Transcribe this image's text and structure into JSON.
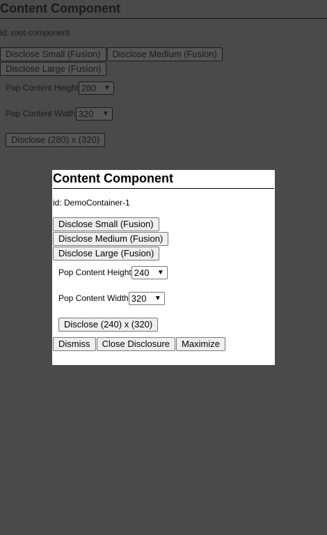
{
  "root": {
    "title": "Content Component",
    "id_text": "id: root-component",
    "buttons": {
      "small": "Disclose Small (Fusion)",
      "medium": "Disclose Medium (Fusion)",
      "large": "Disclose Large (Fusion)"
    },
    "height_label": "Pop Content Height",
    "height_value": "280",
    "width_label": "Pop Content Width",
    "width_value": "320",
    "disclose_custom": "Disclose (280) x (320)"
  },
  "modal": {
    "title": "Content Component",
    "id_text": "id: DemoContainer-1",
    "buttons": {
      "small": "Disclose Small (Fusion)",
      "medium": "Disclose Medium (Fusion)",
      "large": "Disclose Large (Fusion)"
    },
    "height_label": "Pop Content Height",
    "height_value": "240",
    "width_label": "Pop Content Width",
    "width_value": "320",
    "disclose_custom": "Disclose (240) x (320)",
    "actions": {
      "dismiss": "Dismiss",
      "close": "Close Disclosure",
      "maximize": "Maximize"
    }
  }
}
